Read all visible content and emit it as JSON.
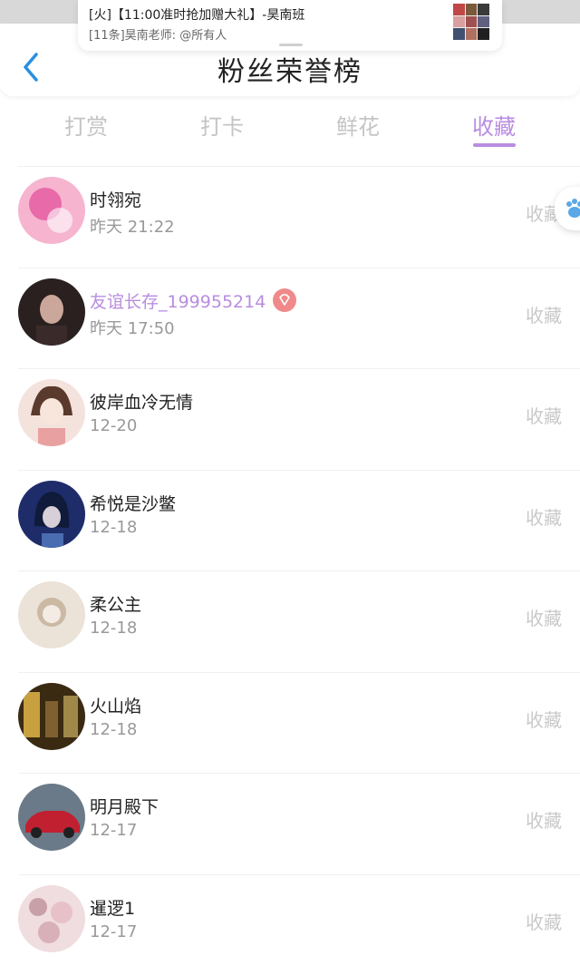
{
  "notification": {
    "title": "[火]【11:00准时抢加赠大礼】-昊南班",
    "subtitle": "[11条]昊南老师: @所有人"
  },
  "header": {
    "title": "粉丝荣誉榜"
  },
  "tabs": [
    {
      "label": "打赏",
      "active": false
    },
    {
      "label": "打卡",
      "active": false
    },
    {
      "label": "鲜花",
      "active": false
    },
    {
      "label": "收藏",
      "active": true
    }
  ],
  "rows": [
    {
      "name": "时翎宛",
      "time": "昨天 21:22",
      "action": "收藏",
      "highlight": false,
      "badge": false,
      "avatar_colors": [
        "#f6b4cf",
        "#e86aa8"
      ]
    },
    {
      "name": "友谊长存_199955214",
      "time": "昨天 17:50",
      "action": "收藏",
      "highlight": true,
      "badge": true,
      "avatar_colors": [
        "#2a2020",
        "#caa79a"
      ]
    },
    {
      "name": "彼岸血冷无情",
      "time": "12-20",
      "action": "收藏",
      "highlight": false,
      "badge": false,
      "avatar_colors": [
        "#f4e2dc",
        "#5a3a2c"
      ]
    },
    {
      "name": "希悦是沙鳖",
      "time": "12-18",
      "action": "收藏",
      "highlight": false,
      "badge": false,
      "avatar_colors": [
        "#1e2c6a",
        "#4a6cb0"
      ]
    },
    {
      "name": "柔公主",
      "time": "12-18",
      "action": "收藏",
      "highlight": false,
      "badge": false,
      "avatar_colors": [
        "#ebe2d8",
        "#cbb9a4"
      ]
    },
    {
      "name": "火山焰",
      "time": "12-18",
      "action": "收藏",
      "highlight": false,
      "badge": false,
      "avatar_colors": [
        "#3a2a12",
        "#c8a040"
      ]
    },
    {
      "name": "明月殿下",
      "time": "12-17",
      "action": "收藏",
      "highlight": false,
      "badge": false,
      "avatar_colors": [
        "#6a7a88",
        "#c02030"
      ]
    },
    {
      "name": "暹逻1",
      "time": "12-17",
      "action": "收藏",
      "highlight": false,
      "badge": false,
      "avatar_colors": [
        "#f0dde0",
        "#c8a0a8"
      ]
    }
  ],
  "colors": {
    "accent": "#b88de0",
    "muted": "#c4c4c4",
    "badge": "#f08a8a"
  }
}
